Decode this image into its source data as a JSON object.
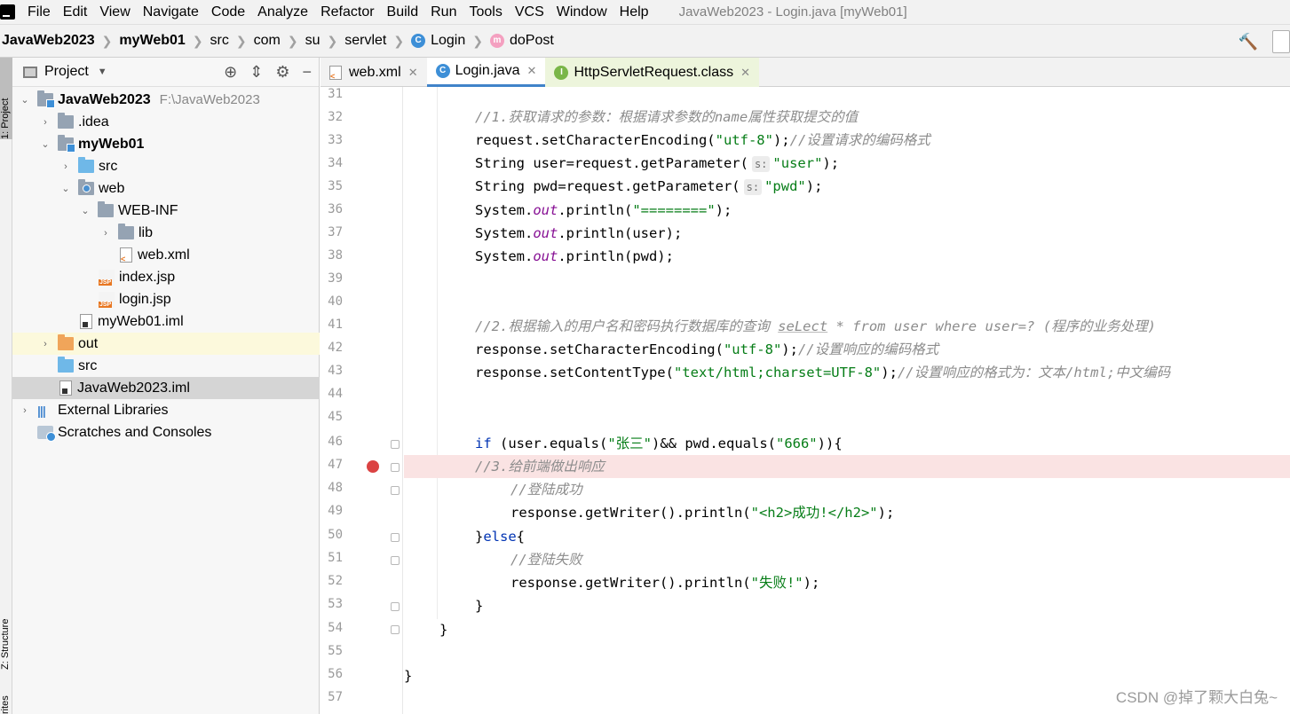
{
  "menubar": {
    "items": [
      "File",
      "Edit",
      "View",
      "Navigate",
      "Code",
      "Analyze",
      "Refactor",
      "Build",
      "Run",
      "Tools",
      "VCS",
      "Window",
      "Help"
    ],
    "window_title": "JavaWeb2023 - Login.java [myWeb01]"
  },
  "breadcrumb": [
    "JavaWeb2023",
    "myWeb01",
    "src",
    "com",
    "su",
    "servlet",
    "Login",
    "doPost"
  ],
  "strip": {
    "project_tab": "1: Project",
    "structure_tab": "Z: Structure",
    "favorites_tab": "rites"
  },
  "project": {
    "title": "Project",
    "root_path": "F:\\JavaWeb2023",
    "tree": [
      "JavaWeb2023",
      ".idea",
      "myWeb01",
      "src",
      "web",
      "WEB-INF",
      "lib",
      "web.xml",
      "index.jsp",
      "login.jsp",
      "myWeb01.iml",
      "out",
      "src",
      "JavaWeb2023.iml",
      "External Libraries",
      "Scratches and Consoles"
    ]
  },
  "tabs": [
    "web.xml",
    "Login.java",
    "HttpServletRequest.class"
  ],
  "editor": {
    "line_numbers": [
      "31",
      "32",
      "33",
      "34",
      "35",
      "36",
      "37",
      "38",
      "39",
      "40",
      "41",
      "42",
      "43",
      "44",
      "45",
      "46",
      "47",
      "48",
      "49",
      "50",
      "51",
      "52",
      "53",
      "54",
      "55",
      "56",
      "57"
    ],
    "hint_s": "s:",
    "c32": "//1.获取请求的参数：根据请求参数的name属性获取提交的值",
    "c33a": "request.setCharacterEncoding(",
    "c33s": "\"utf-8\"",
    "c33b": ");",
    "c33c": "//设置请求的编码格式",
    "c34a": "String user=request.getParameter(",
    "c34s": "\"user\"",
    "c34b": ");",
    "c35a": "String pwd=request.getParameter(",
    "c35s": "\"pwd\"",
    "c35b": ");",
    "sys": "System.",
    "out": "out",
    "c36b": ".println(",
    "c36s": "\"========\"",
    "c36c": ");",
    "c37b": ".println(user);",
    "c38b": ".println(pwd);",
    "c41a": "//2.根据输入的用户名和密码执行数据库的查询 ",
    "c41k": "seLect",
    "c41b": " * from user where user=? (程序的业务处理)",
    "c42a": "response.setCharacterEncoding(",
    "c42s": "\"utf-8\"",
    "c42b": ");",
    "c42c": "//设置响应的编码格式",
    "c43a": "response.setContentType(",
    "c43s": "\"text/html;charset=UTF-8\"",
    "c43b": ");",
    "c43c": "//设置响应的格式为：文本/html;中文编码",
    "c46k": "if",
    "c46a": " (user.equals(",
    "c46s1": "\"张三\"",
    "c46b": ")&& pwd.equals(",
    "c46s2": "\"666\"",
    "c46c": ")){",
    "c47": "//3.给前端做出响应",
    "c48": "//登陆成功",
    "c49a": "response.getWriter().println(",
    "c49s": "\"<h2>成功!</h2>\"",
    "c49b": ");",
    "c50a": "}",
    "c50k": "else",
    "c50b": "{",
    "c51": "//登陆失败",
    "c52a": "response.getWriter().println(",
    "c52s": "\"失败!\"",
    "c52b": ");",
    "brace": "}"
  },
  "watermark": "CSDN @掉了颗大白兔~"
}
